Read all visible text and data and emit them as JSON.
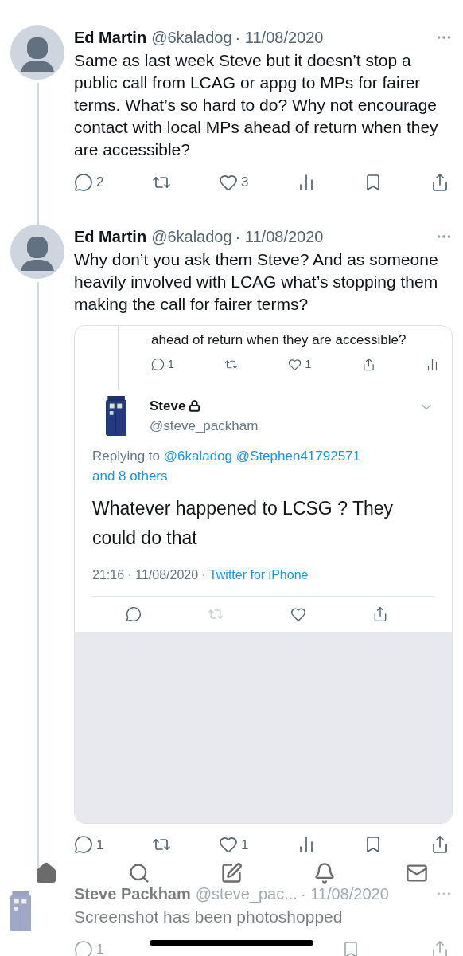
{
  "tweets": [
    {
      "name": "Ed Martin",
      "handle": "@6kaladog",
      "date": "· 11/08/2020",
      "text": "Same as last week Steve but it doesn’t stop a public call from LCAG or appg to MPs for fairer terms. What’s so hard to do? Why not encourage contact with local MPs ahead of return when they are accessible?",
      "avatar": {
        "kind": "silhouette"
      },
      "actions": [
        {
          "kind": "reply",
          "count": "2"
        },
        {
          "kind": "retweet"
        },
        {
          "kind": "like",
          "count": "3"
        },
        {
          "kind": "views"
        },
        {
          "kind": "bookmark"
        },
        {
          "kind": "share"
        }
      ]
    },
    {
      "name": "Ed Martin",
      "handle": "@6kaladog",
      "date": "· 11/08/2020",
      "text": "Why don’t you ask them Steve? And as someone heavily involved with LCAG what’s stopping them making the call for fairer terms?",
      "avatar": {
        "kind": "silhouette"
      },
      "quote": {
        "top_text": "ahead of return when they are accessible?",
        "top_actions": [
          {
            "kind": "reply",
            "count": "1",
            "disabled": false
          },
          {
            "kind": "retweet",
            "disabled": false
          },
          {
            "kind": "like",
            "count": "1",
            "disabled": false
          },
          {
            "kind": "share",
            "disabled": false
          },
          {
            "kind": "views",
            "disabled": false
          }
        ],
        "name": "Steve",
        "locked": true,
        "handle": "@steve_packham",
        "replying_prefix": "Replying to",
        "replying_links": [
          "@6kaladog",
          "@Stephen41792571",
          "and 8 others"
        ],
        "text": "Whatever happened to LCSG ? They could do that",
        "time": "21:16 · 11/08/2020 ·",
        "source": "Twitter for iPhone",
        "actions": [
          {
            "kind": "reply",
            "disabled": false
          },
          {
            "kind": "retweet",
            "disabled": true
          },
          {
            "kind": "like",
            "disabled": false
          },
          {
            "kind": "share",
            "disabled": false
          }
        ]
      },
      "actions": [
        {
          "kind": "reply",
          "count": "1"
        },
        {
          "kind": "retweet"
        },
        {
          "kind": "like",
          "count": "1"
        },
        {
          "kind": "views"
        },
        {
          "kind": "bookmark"
        },
        {
          "kind": "share"
        }
      ]
    },
    {
      "name": "Steve Packham",
      "handle": "@steve_pac...",
      "date": "· 11/08/2020",
      "text": "Screenshot has been photoshopped",
      "avatar": {
        "kind": "police-box"
      },
      "faded": true,
      "actions": [
        {
          "kind": "reply",
          "count": "1"
        },
        {
          "kind": "bookmark"
        },
        {
          "kind": "share"
        }
      ]
    }
  ],
  "tab_bar": [
    {
      "kind": "home",
      "selected": true
    },
    {
      "kind": "search",
      "selected": false
    },
    {
      "kind": "compose",
      "selected": false
    },
    {
      "kind": "notifications",
      "selected": false
    },
    {
      "kind": "messages",
      "selected": false
    }
  ]
}
